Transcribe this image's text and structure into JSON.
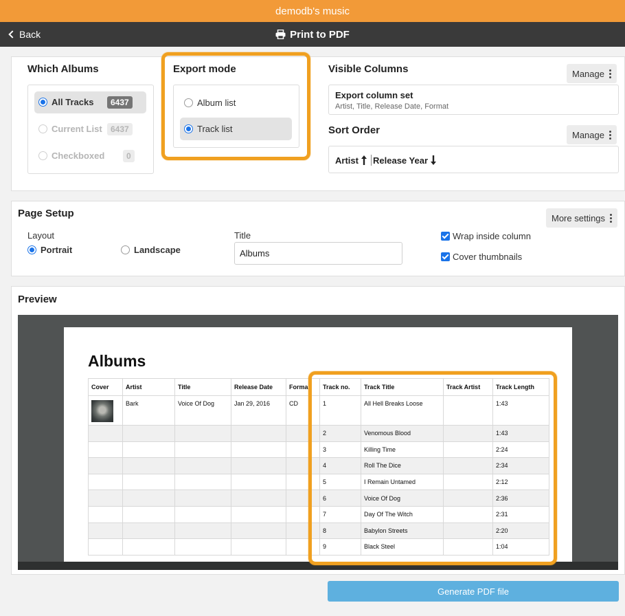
{
  "app": {
    "title": "demodb's music"
  },
  "nav": {
    "back_label": "Back",
    "title": "Print to PDF"
  },
  "which_albums": {
    "heading": "Which Albums",
    "options": [
      {
        "label": "All Tracks",
        "count": "6437"
      },
      {
        "label": "Current List",
        "count": "6437"
      },
      {
        "label": "Checkboxed",
        "count": "0"
      }
    ]
  },
  "export_mode": {
    "heading": "Export mode",
    "options": [
      {
        "label": "Album list"
      },
      {
        "label": "Track list"
      }
    ]
  },
  "visible_columns": {
    "heading": "Visible Columns",
    "manage_label": "Manage",
    "set_title": "Export column set",
    "set_columns": "Artist, Title, Release Date, Format"
  },
  "sort_order": {
    "heading": "Sort Order",
    "manage_label": "Manage",
    "keys": [
      {
        "label": "Artist",
        "dir": "up"
      },
      {
        "label": "Release Year",
        "dir": "down"
      }
    ]
  },
  "page_setup": {
    "heading": "Page Setup",
    "more_label": "More settings",
    "layout_label": "Layout",
    "portrait_label": "Portrait",
    "landscape_label": "Landscape",
    "title_label": "Title",
    "title_value": "Albums",
    "wrap_label": "Wrap inside column",
    "cover_label": "Cover thumbnails"
  },
  "preview": {
    "heading": "Preview",
    "doc_title": "Albums",
    "headers": [
      "Cover",
      "Artist",
      "Title",
      "Release Date",
      "Forma",
      "Track no.",
      "Track Title",
      "Track Artist",
      "Track Length"
    ],
    "first_row": {
      "artist": "Bark",
      "title": "Voice Of Dog",
      "release_date": "Jan 29, 2016",
      "format": "CD",
      "track_no": "1",
      "track_title": "All Hell Breaks Loose",
      "track_artist": "",
      "track_length": "1:43"
    },
    "tracks": [
      {
        "no": "2",
        "title": "Venomous Blood",
        "length": "1:43"
      },
      {
        "no": "3",
        "title": "Killing Time",
        "length": "2:24"
      },
      {
        "no": "4",
        "title": "Roll The Dice",
        "length": "2:34"
      },
      {
        "no": "5",
        "title": "I Remain Untamed",
        "length": "2:12"
      },
      {
        "no": "6",
        "title": "Voice Of Dog",
        "length": "2:36"
      },
      {
        "no": "7",
        "title": "Day Of The Witch",
        "length": "2:31"
      },
      {
        "no": "8",
        "title": "Babylon Streets",
        "length": "2:20"
      },
      {
        "no": "9",
        "title": "Black Steel",
        "length": "1:04"
      }
    ]
  },
  "footer": {
    "generate_label": "Generate PDF file"
  }
}
